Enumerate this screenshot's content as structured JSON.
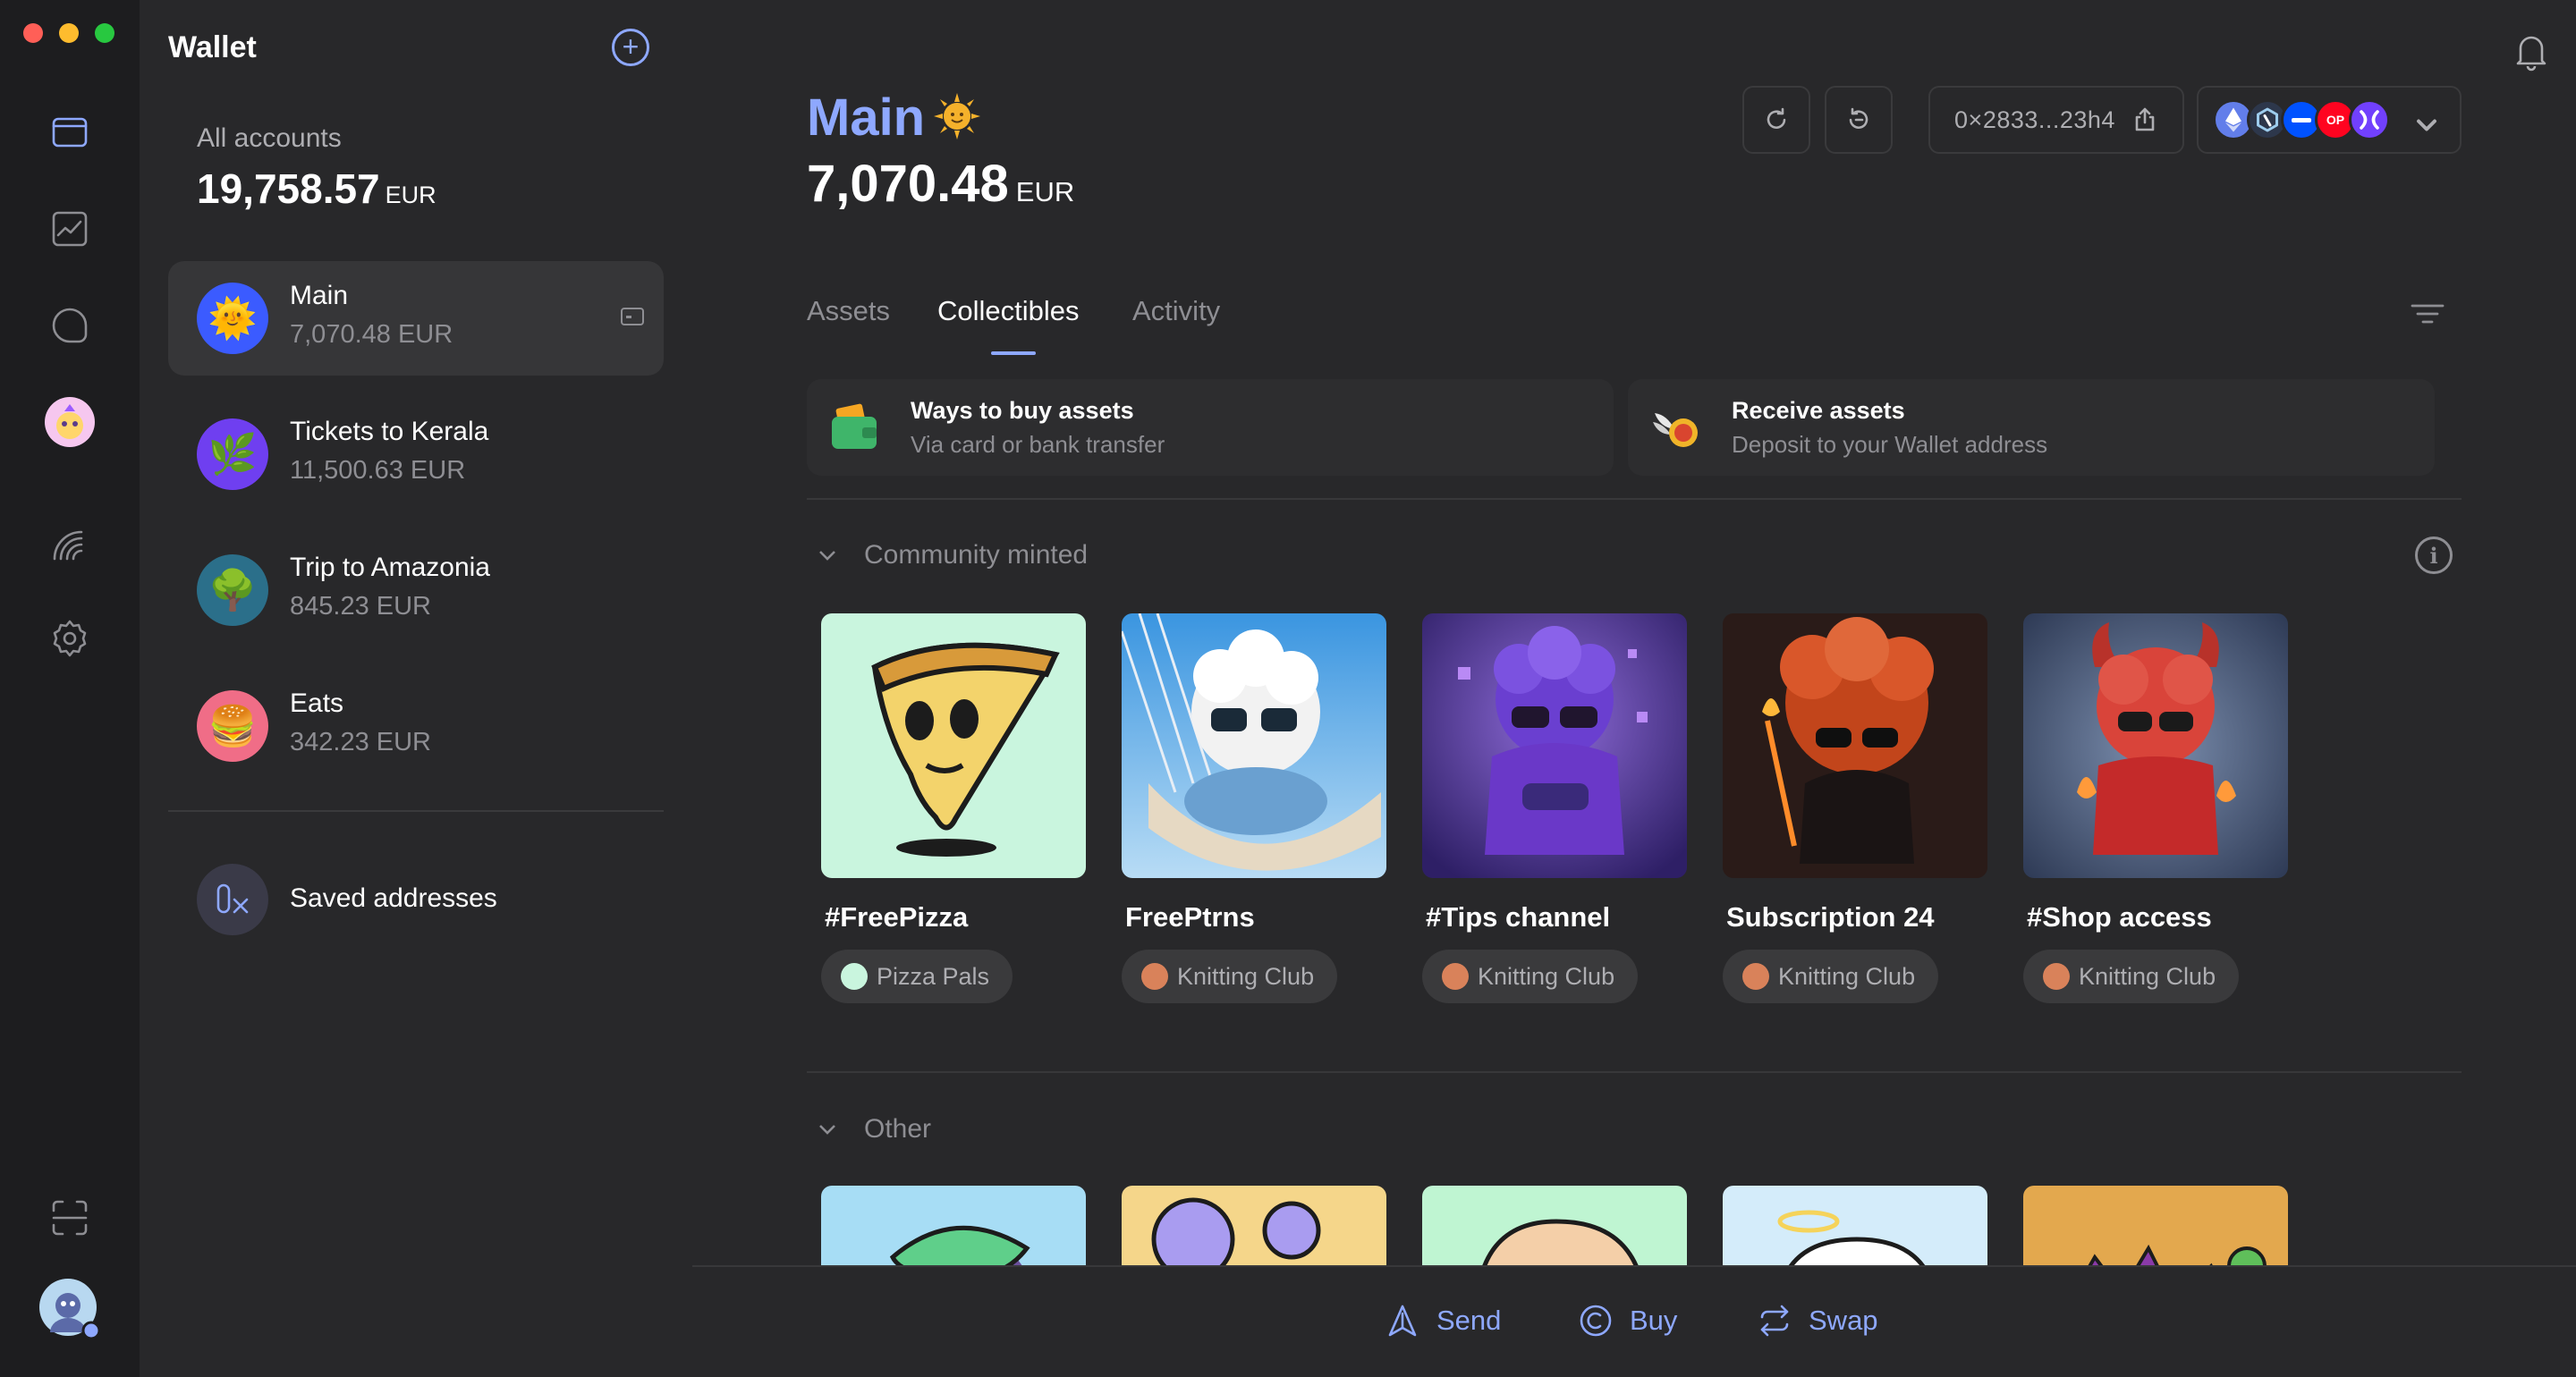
{
  "window": {
    "title": "Wallet"
  },
  "rail": {
    "items": [
      {
        "name": "wallet-icon",
        "active": true
      },
      {
        "name": "chart-icon",
        "active": false
      },
      {
        "name": "chat-icon",
        "active": false
      },
      {
        "name": "dapp-avatar-icon",
        "active": false
      },
      {
        "name": "rainbow-icon",
        "active": false
      },
      {
        "name": "settings-icon",
        "active": false
      },
      {
        "name": "scan-icon",
        "active": false
      },
      {
        "name": "profile-avatar",
        "active": false
      }
    ]
  },
  "sidebar": {
    "title": "Wallet",
    "all_label": "All accounts",
    "all_total": "19,758.57",
    "all_currency": "EUR",
    "accounts": [
      {
        "name": "Main",
        "balance": "7,070.48 EUR",
        "emoji": "🌞",
        "color": "#3b5bff",
        "selected": true
      },
      {
        "name": "Tickets to Kerala",
        "balance": "11,500.63 EUR",
        "emoji": "🌿",
        "color": "#6f3ff0",
        "selected": false
      },
      {
        "name": "Trip to Amazonia",
        "balance": "845.23 EUR",
        "emoji": "🌳",
        "color": "#2b6f8a",
        "selected": false
      },
      {
        "name": "Eats",
        "balance": "342.23 EUR",
        "emoji": "🍔",
        "color": "#f06d87",
        "selected": false
      }
    ],
    "saved_label": "Saved addresses"
  },
  "header": {
    "account_name": "Main",
    "balance": "7,070.48",
    "currency": "EUR",
    "address": "0×2833...23h4",
    "chains": [
      {
        "name": "ethereum",
        "color": "#627eea",
        "label": ""
      },
      {
        "name": "arbitrum",
        "color": "#2d374b",
        "label": ""
      },
      {
        "name": "optimism-base",
        "color": "#0052ff",
        "label": ""
      },
      {
        "name": "op",
        "color": "#ff0420",
        "label": "OP"
      },
      {
        "name": "status",
        "color": "#7140fd",
        "label": ""
      }
    ]
  },
  "tabs": [
    "Assets",
    "Collectibles",
    "Activity"
  ],
  "active_tab": "Collectibles",
  "promos": [
    {
      "title": "Ways to buy assets",
      "subtitle": "Via card or bank transfer"
    },
    {
      "title": "Receive assets",
      "subtitle": "Deposit to your Wallet address"
    }
  ],
  "sections": {
    "community": "Community minted",
    "other": "Other"
  },
  "collectibles": [
    {
      "title": "#FreePizza",
      "collection": "Pizza Pals",
      "bg": "#c9f5de"
    },
    {
      "title": "FreePtrns",
      "collection": "Knitting Club",
      "bg": "#8cc3ef"
    },
    {
      "title": "#Tips channel",
      "collection": "Knitting Club",
      "bg": "#6a4fc0"
    },
    {
      "title": "Subscription 24",
      "collection": "Knitting Club",
      "bg": "#2a1b18"
    },
    {
      "title": "#Shop access",
      "collection": "Knitting Club",
      "bg": "#4a5d7e"
    }
  ],
  "other_collectibles": [
    {
      "bg": "#a7ddf5"
    },
    {
      "bg": "#f5d68a"
    },
    {
      "bg": "#bff5d2"
    },
    {
      "bg": "#d4ecfa"
    },
    {
      "bg": "#e3a84e"
    }
  ],
  "actions": {
    "send": "Send",
    "buy": "Buy",
    "swap": "Swap"
  }
}
